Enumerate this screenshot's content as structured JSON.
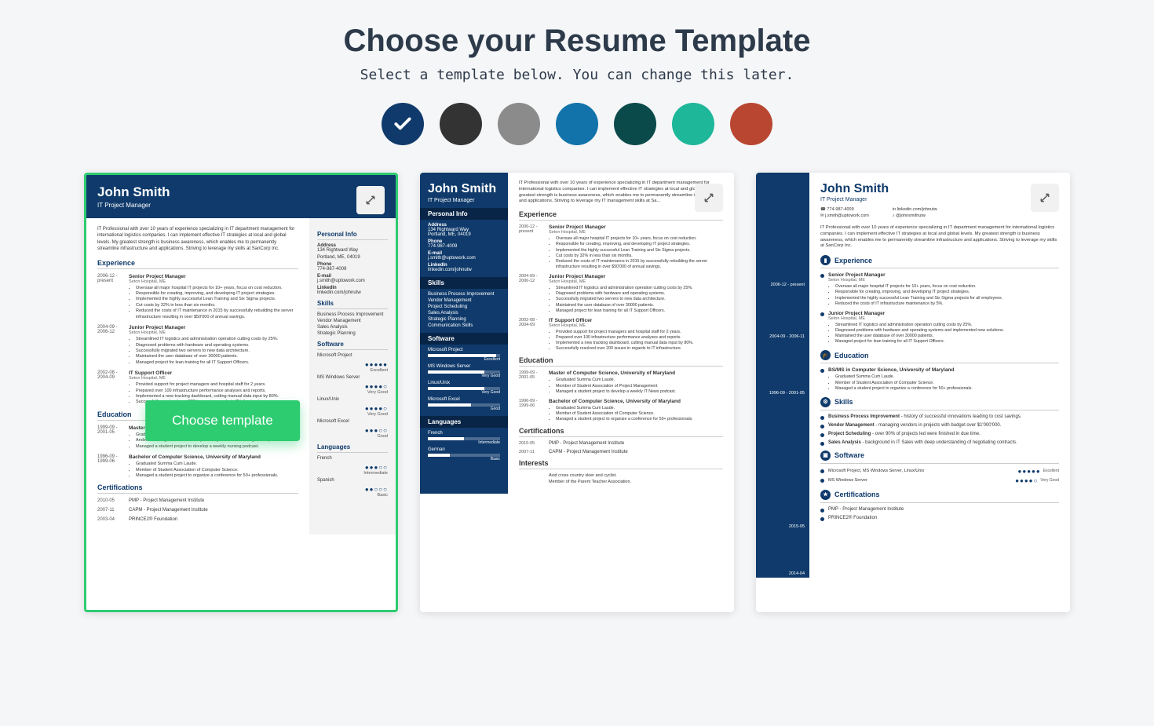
{
  "header": {
    "title": "Choose your Resume Template",
    "subtitle": "Select a template below. You can change this later."
  },
  "colors": [
    {
      "hex": "#0f3a6b",
      "selected": true
    },
    {
      "hex": "#333333",
      "selected": false
    },
    {
      "hex": "#8b8b8b",
      "selected": false
    },
    {
      "hex": "#1173a9",
      "selected": false
    },
    {
      "hex": "#0b4a4a",
      "selected": false
    },
    {
      "hex": "#1eb79a",
      "selected": false
    },
    {
      "hex": "#b94630",
      "selected": false
    }
  ],
  "choose_button": "Choose template",
  "resume": {
    "name": "John Smith",
    "role": "IT Project Manager",
    "summary": "IT Professional with over 10 years of experience specializing in IT department management for international logistics companies. I can implement effective IT strategies at local and global levels. My greatest strength is business awareness, which enables me to permanently streamline infrastructure and applications. Striving to leverage my skills at SanCorp Inc.",
    "summary_short": "IT Professional with over 10 years of experience specializing in IT department management for international logistics companies. I can implement effective IT strategies at local and global levels. My greatest strength is business awareness, which enables me to permanently streamline infrastructure and applications. Striving to leverage my IT management skills at Sa...",
    "contacts": {
      "address_label": "Address",
      "address_line1": "134 Rightward Way",
      "address_line2": "Portland, ME, 04019",
      "phone_label": "Phone",
      "phone": "774-987-4009",
      "email_label": "E-mail",
      "email": "j.smith@uptowork.com",
      "linkedin_label": "LinkedIn",
      "linkedin": "linkedin.com/johnutw",
      "twitter": "@johnsmithutw"
    },
    "sections": {
      "personal_info": "Personal Info",
      "experience": "Experience",
      "education": "Education",
      "certifications": "Certifications",
      "skills": "Skills",
      "software": "Software",
      "languages": "Languages",
      "interests": "Interests"
    },
    "experience": [
      {
        "date": "2006-12 - present",
        "title": "Senior Project Manager",
        "location": "Seton Hospital, ME",
        "bullets": [
          "Oversaw all major hospital IT projects for 10+ years, focus on cost reduction.",
          "Responsible for creating, improving, and developing IT project strategies.",
          "Implemented the highly successful Lean Training and Six Sigma projects.",
          "Cut costs by 32% in less than six months.",
          "Reduced the costs of IT maintenance in 2015 by successfully rebuilding the server infrastructure resulting in over $50'000 of annual savings."
        ]
      },
      {
        "date": "2004-09 - 2006-12",
        "title": "Junior Project Manager",
        "location": "Seton Hospital, ME",
        "bullets": [
          "Streamlined IT logistics and administration operation cutting costs by 25%.",
          "Diagnosed problems with hardware and operating systems.",
          "Successfully migrated two servers to new data architecture.",
          "Maintained the user database of over 30000 patients.",
          "Managed project for lean training for all IT Support Officers."
        ]
      },
      {
        "date": "2002-08 - 2004-09",
        "title": "IT Support Officer",
        "location": "Seton Hospital, ME",
        "bullets": [
          "Provided support for project managers and hospital staff for 2 years.",
          "Prepared over 100 infrastructure performance analyses and reports.",
          "Implemented a new tracking dashboard, cutting manual data input by 80%.",
          "Successfully resolved over 200 issues in regards to IT infrastructure."
        ]
      }
    ],
    "experience_t3": [
      {
        "date": "2006-12 - present",
        "title": "Senior Project Manager",
        "location": "Seton Hospital, ME",
        "bullets": [
          "Oversaw all major hospital IT projects for 10+ years, focus on cost reduction.",
          "Responsible for creating, improving, and developing IT project strategies.",
          "Implemented the highly successful Lean Training and Six Sigma projects for all employees.",
          "Reduced the costs of IT infrastructure maintenance by 5%."
        ]
      },
      {
        "date": "2004-09 - 2006-11",
        "title": "Junior Project Manager",
        "location": "Seton Hospital, ME",
        "bullets": [
          "Streamlined IT logistics and administration operation cutting costs by 25%.",
          "Diagnosed problems with hardware and operating systems and implemented new solutions.",
          "Maintained the user database of over 30000 patients.",
          "Managed project for lean training for all IT Support Officers."
        ]
      }
    ],
    "education": [
      {
        "date": "1999-09 - 2001-05",
        "title": "Master of Computer Science, University of Maryland",
        "bullets": [
          "Graduated Summa Cum Laude.",
          "Andersen Postgraduate Fellowship to study advanced nursing techniques.",
          "Managed a student project to develop a weekly nursing podcast."
        ]
      },
      {
        "date": "1996-09 - 1999-06",
        "title": "Bachelor of Computer Science, University of Maryland",
        "bullets": [
          "Graduated Summa Cum Laude.",
          "Member of Student Association of Computer Science.",
          "Managed a student project to organize a conference for 50+ professionals."
        ]
      }
    ],
    "education_t2": [
      {
        "date": "1999-09 - 2001-05",
        "title": "Master of Computer Science, University of Maryland",
        "bullets": [
          "Graduated Summa Cum Laude.",
          "Member of Student Association of Project Management",
          "Managed a student project to develop a weekly IT News podcast."
        ]
      },
      {
        "date": "1996-09 - 1999-06",
        "title": "Bachelor of Computer Science, University of Maryland",
        "bullets": [
          "Graduated Summa Cum Laude.",
          "Member of Student Association of Computer Science.",
          "Managed a student project to organize a conference for 50+ professionals."
        ]
      }
    ],
    "education_t3": [
      {
        "date": "1996-09 - 2001-05",
        "title": "BS/MS in Computer Science, University of Maryland",
        "bullets": [
          "Graduated Summa Cum Laude.",
          "Member of Student Association of Computer Science.",
          "Managed a student project to organize a conference for 50+ professionals."
        ]
      }
    ],
    "certifications": [
      {
        "date": "2010-05",
        "text": "PMP - Project Management Institute"
      },
      {
        "date": "2007-11",
        "text": "CAPM - Project Management Institute"
      },
      {
        "date": "2003-04",
        "text": "PRINCE2® Foundation"
      }
    ],
    "certifications_t3": [
      {
        "date": "2015-05",
        "text": "PMP - Project Management Institute"
      },
      {
        "date": "2014-04",
        "text": "PRINCE2® Foundation"
      }
    ],
    "skills": [
      "Business Process Improvement",
      "Vendor Management",
      "Sales Analysis",
      "Strategic Planning"
    ],
    "skills_t2": [
      "Business Process Improvement",
      "Vendor Management",
      "Project Scheduling",
      "Sales Analysis",
      "Strategic Planning",
      "Communication Skills"
    ],
    "skills_t3": [
      {
        "name": "Business Process Improvement",
        "desc": "history of successful innovations leading to cost savings."
      },
      {
        "name": "Vendor Management",
        "desc": "managing vendors in projects with budget over $1'000'000."
      },
      {
        "name": "Project Scheduling",
        "desc": "over 90% of projects led were finished in due time."
      },
      {
        "name": "Sales Analysis",
        "desc": "background in IT Sales with deep understanding of negotiating contracts."
      }
    ],
    "software": [
      {
        "name": "Microsoft Project",
        "rating": "Excellent",
        "dots": "●●●●●"
      },
      {
        "name": "MS Windows Server",
        "rating": "Very Good",
        "dots": "●●●●○"
      },
      {
        "name": "Linux/Unix",
        "rating": "Very Good",
        "dots": "●●●●○"
      },
      {
        "name": "Microsoft Excel",
        "rating": "Good",
        "dots": "●●●○○"
      }
    ],
    "software_t3_combined": "Microsoft Project, MS Windows Server, Linux/Unix",
    "software_t3_row2": "MS Windows Server",
    "languages": [
      {
        "name": "French",
        "rating": "Intermediate",
        "dots": "●●●○○"
      },
      {
        "name": "Spanish",
        "rating": "Basic",
        "dots": "●●○○○"
      }
    ],
    "languages_t2": [
      {
        "name": "French",
        "rating": "Intermediate"
      },
      {
        "name": "German",
        "rating": "Basic"
      }
    ],
    "interests": [
      "Avid cross country skier and cyclist.",
      "Member of the Parent Teacher Association."
    ]
  }
}
